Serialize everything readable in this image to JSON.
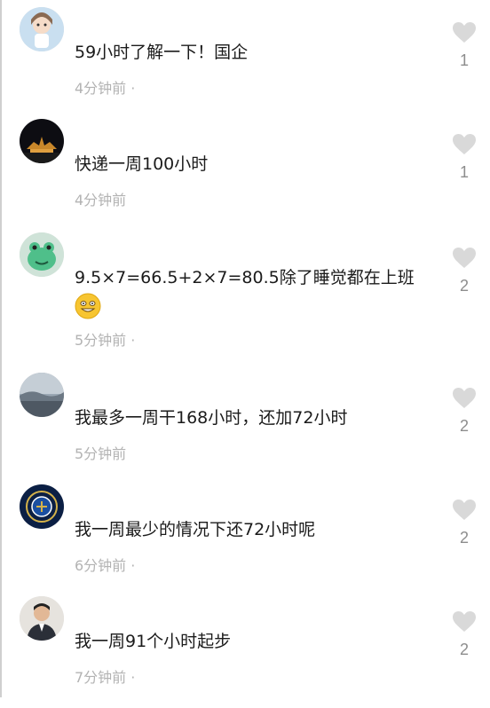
{
  "comments": [
    {
      "avatar": "avatar-cartoon-girl",
      "text": "59小时了解一下！国企",
      "time": "4分钟前 ·",
      "likes": "1"
    },
    {
      "avatar": "avatar-night-building",
      "text": "快递一周100小时",
      "time": "4分钟前",
      "likes": "1"
    },
    {
      "avatar": "avatar-frog",
      "text": "9.5×7=66.5+2×7=80.5除了睡觉都在上班",
      "emoji": "grin-emoji",
      "time": "5分钟前 ·",
      "likes": "2"
    },
    {
      "avatar": "avatar-cloudy-sky",
      "text": "我最多一周干168小时，还加72小时",
      "time": "5分钟前",
      "likes": "2"
    },
    {
      "avatar": "avatar-inter-badge",
      "text": "我一周最少的情况下还72小时呢",
      "time": "6分钟前 ·",
      "likes": "2"
    },
    {
      "avatar": "avatar-person-photo",
      "text": "我一周91个小时起步",
      "time": "7分钟前 ·",
      "likes": "2"
    }
  ],
  "icons": {
    "like": "heart-icon"
  },
  "colors": {
    "text": "#1b1b1b",
    "meta": "#b3b3b3",
    "heart": "#d9d9d9",
    "count": "#8d8d8d"
  }
}
